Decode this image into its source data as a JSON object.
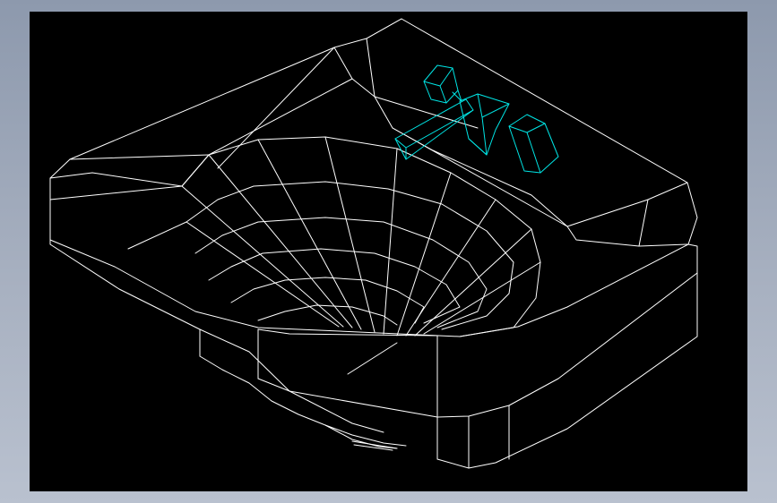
{
  "viewport": {
    "background": "#000000",
    "wireframe_color": "#ffffff",
    "highlight_color": "#00e5e5"
  },
  "model": {
    "body": "washbasin-wireframe",
    "fixture": "faucet-wireframe"
  }
}
